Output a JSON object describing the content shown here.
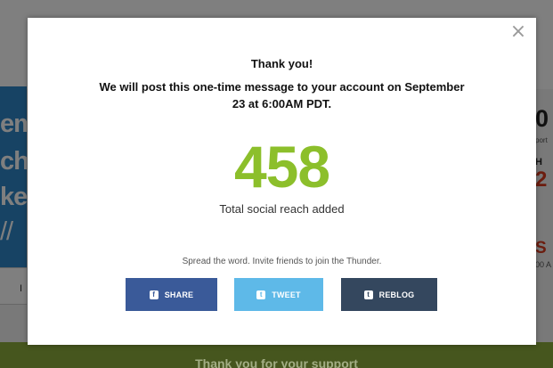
{
  "background": {
    "hero_lines": [
      "em",
      "cha",
      "ke",
      "//"
    ],
    "input_char": "I",
    "right_big": "0",
    "right_small": "port",
    "right_h": "H",
    "right_red": "2",
    "right_s": "S",
    "right_s2": "00 A",
    "footer_text": "Thank you for your support"
  },
  "modal": {
    "close_symbol": "×",
    "title": "Thank you!",
    "message": "We will post this one-time message to your account on September 23 at 6:00AM PDT.",
    "reach_number": "458",
    "reach_label": "Total social reach added",
    "spread_text": "Spread the word. Invite friends to join the Thunder.",
    "buttons": [
      {
        "label": "SHARE",
        "icon": "facebook-icon",
        "icon_glyph": "f",
        "color": "#3a5a99"
      },
      {
        "label": "TWEET",
        "icon": "twitter-icon",
        "icon_glyph": "t",
        "color": "#5eb9e8"
      },
      {
        "label": "REBLOG",
        "icon": "tumblr-icon",
        "icon_glyph": "t",
        "color": "#34475e"
      }
    ]
  },
  "colors": {
    "accent_green": "#8cbf2b",
    "footer_green": "#8cad3c",
    "hero_blue": "#2f86c9"
  }
}
